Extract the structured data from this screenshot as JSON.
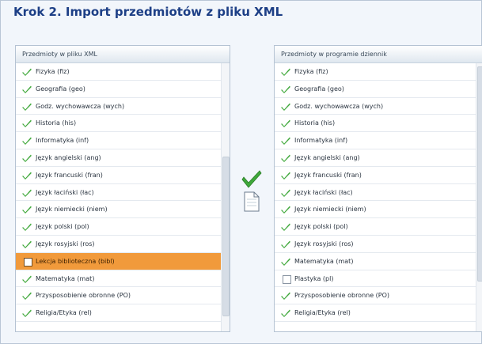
{
  "title": "Krok 2. Import przedmiotów z pliku XML",
  "left_panel": {
    "header": "Przedmioty w pliku XML",
    "items": [
      {
        "label": "Fizyka (fiz)",
        "checked": true
      },
      {
        "label": "Geografia (geo)",
        "checked": true
      },
      {
        "label": "Godz. wychowawcza (wych)",
        "checked": true
      },
      {
        "label": "Historia (his)",
        "checked": true
      },
      {
        "label": "Informatyka (inf)",
        "checked": true
      },
      {
        "label": "Język angielski (ang)",
        "checked": true
      },
      {
        "label": "Język francuski (fran)",
        "checked": true
      },
      {
        "label": "Język łaciński (łac)",
        "checked": true
      },
      {
        "label": "Język niemiecki (niem)",
        "checked": true
      },
      {
        "label": "Język polski (pol)",
        "checked": true
      },
      {
        "label": "Język rosyjski (ros)",
        "checked": true
      },
      {
        "label": "Lekcja biblioteczna (bibl)",
        "checked": false,
        "selected": true
      },
      {
        "label": "Matematyka (mat)",
        "checked": true
      },
      {
        "label": "Przysposobienie obronne (PO)",
        "checked": true
      },
      {
        "label": "Religia/Etyka (rel)",
        "checked": true
      }
    ]
  },
  "right_panel": {
    "header": "Przedmioty w programie dziennik",
    "items": [
      {
        "label": "Fizyka (fiz)",
        "checked": true
      },
      {
        "label": "Geografia (geo)",
        "checked": true
      },
      {
        "label": "Godz. wychowawcza (wych)",
        "checked": true
      },
      {
        "label": "Historia (his)",
        "checked": true
      },
      {
        "label": "Informatyka (inf)",
        "checked": true
      },
      {
        "label": "Język angielski (ang)",
        "checked": true
      },
      {
        "label": "Język francuski (fran)",
        "checked": true
      },
      {
        "label": "Język łaciński (łac)",
        "checked": true
      },
      {
        "label": "Język niemiecki (niem)",
        "checked": true
      },
      {
        "label": "Język polski (pol)",
        "checked": true
      },
      {
        "label": "Język rosyjski (ros)",
        "checked": true
      },
      {
        "label": "Matematyka (mat)",
        "checked": true
      },
      {
        "label": "Plastyka (pl)",
        "checked": false
      },
      {
        "label": "Przysposobienie obronne (PO)",
        "checked": true
      },
      {
        "label": "Religia/Etyka (rel)",
        "checked": true
      }
    ]
  },
  "middle_icons": [
    "checkmark-icon",
    "document-icon"
  ],
  "colors": {
    "title": "#1d3f86",
    "check": "#3fa83a",
    "selected_row": "#f19a3b",
    "panel_border": "#b5c3d3"
  }
}
